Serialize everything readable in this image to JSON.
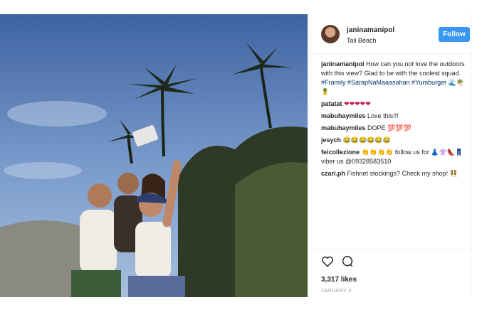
{
  "post": {
    "username": "janinamanipol",
    "location": "Tali Beach",
    "follow_label": "Follow",
    "caption": {
      "user": "janinamanipol",
      "text": "How can you not love the outdoors with this view? Glad to be with the coolest squad.",
      "tags": [
        "#Framily",
        "#SarapNaMaaasahan",
        "#Yumburger"
      ],
      "emoji": "🌊🌴🍍"
    },
    "comments": [
      {
        "user": "patatat",
        "text": "❤❤❤❤❤"
      },
      {
        "user": "mabuhaymiles",
        "text": "Love this!!!"
      },
      {
        "user": "mabuhaymiles",
        "text": "DOPE 💯💯💯"
      },
      {
        "user": "jesych",
        "text": "😂😂😂😂😂😂"
      },
      {
        "user": "feicollezione",
        "text": "👏👏👏👏 follow us for 👗👚👠👖 viber us @09328583510"
      },
      {
        "user": "czari.ph",
        "text": "Fishnet stockings? Check my shop! 👯"
      }
    ],
    "likes": "3,317 likes",
    "date": "JANUARY 3",
    "icons": {
      "like": "heart-icon",
      "comment": "comment-icon"
    }
  },
  "colors": {
    "accent": "#3897f0",
    "sky": "#5b7fb5",
    "tag": "#003569"
  }
}
